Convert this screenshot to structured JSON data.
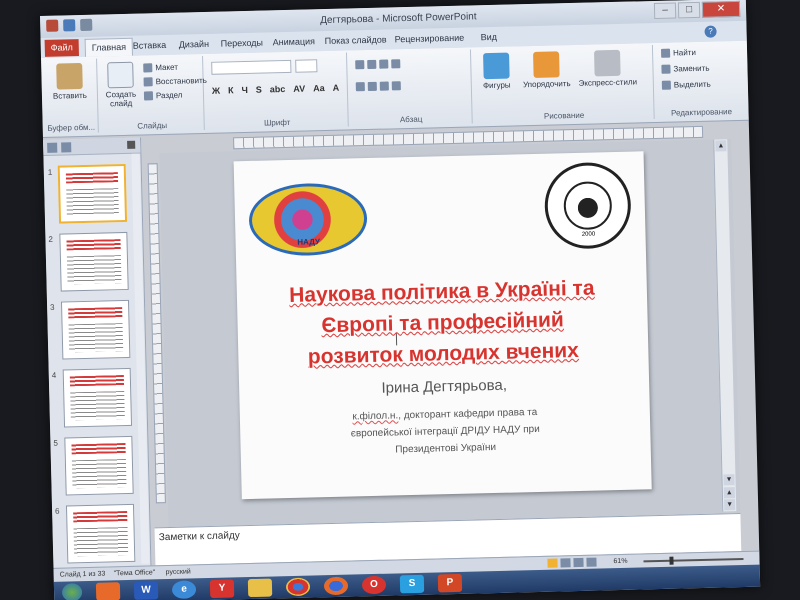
{
  "window": {
    "title": "Дегтярьова - Microsoft PowerPoint",
    "controls": {
      "minimize": "–",
      "maximize": "□",
      "close": "✕"
    }
  },
  "ribbon": {
    "file_tab": "Файл",
    "tabs": [
      "Главная",
      "Вставка",
      "Дизайн",
      "Переходы",
      "Анимация",
      "Показ слайдов",
      "Рецензирование",
      "Вид"
    ],
    "help": "?",
    "clipboard": {
      "paste": "Вставить",
      "group": "Буфер обм..."
    },
    "slides": {
      "new_slide": "Создать слайд",
      "layout": "Макет",
      "reset": "Восстановить",
      "section": "Раздел",
      "group": "Слайды"
    },
    "font": {
      "group": "Шрифт",
      "format_buttons": [
        "Ж",
        "К",
        "Ч",
        "S",
        "abc",
        "AV",
        "Aa",
        "A"
      ]
    },
    "paragraph": {
      "group": "Абзац"
    },
    "drawing": {
      "shapes": "Фигуры",
      "arrange": "Упорядочить",
      "quick_styles": "Экспресс-стили",
      "group": "Рисование"
    },
    "editing": {
      "find": "Найти",
      "replace": "Заменить",
      "select": "Выделить",
      "group": "Редактирование"
    }
  },
  "thumbnails": {
    "numbers": [
      "1",
      "2",
      "3",
      "4",
      "5",
      "6"
    ],
    "selected_index": 0
  },
  "slide": {
    "logo1_text": "НАДУ",
    "logo2_year": "2000",
    "title_lines": [
      "Наукова політика в Україні та",
      "Європі та професійний",
      "розвиток молодих вчених"
    ],
    "author": "Ірина Дегтярьова,",
    "subtitle_prefix": "к.філол.н.",
    "subtitle_rest": ", докторант кафедри права та",
    "subtitle_line2": "європейської інтеграції ДРІДУ НАДУ при",
    "subtitle_line3": "Президентові України"
  },
  "notes": {
    "placeholder": "Заметки к слайду"
  },
  "status": {
    "slide_info": "Слайд 1 из 33",
    "theme": "\"Тема Office\"",
    "language": "русский",
    "zoom": "61%",
    "zoom_level": 0.61
  },
  "taskbar": {
    "items": [
      "start",
      "media",
      "word",
      "ie",
      "yandex",
      "explorer",
      "chrome",
      "firefox",
      "opera",
      "skype",
      "powerpoint"
    ]
  },
  "colors": {
    "title_red": "#d8342f",
    "powerpoint_file_tab": "#c33d2f",
    "selected_thumb": "#f0b230"
  }
}
